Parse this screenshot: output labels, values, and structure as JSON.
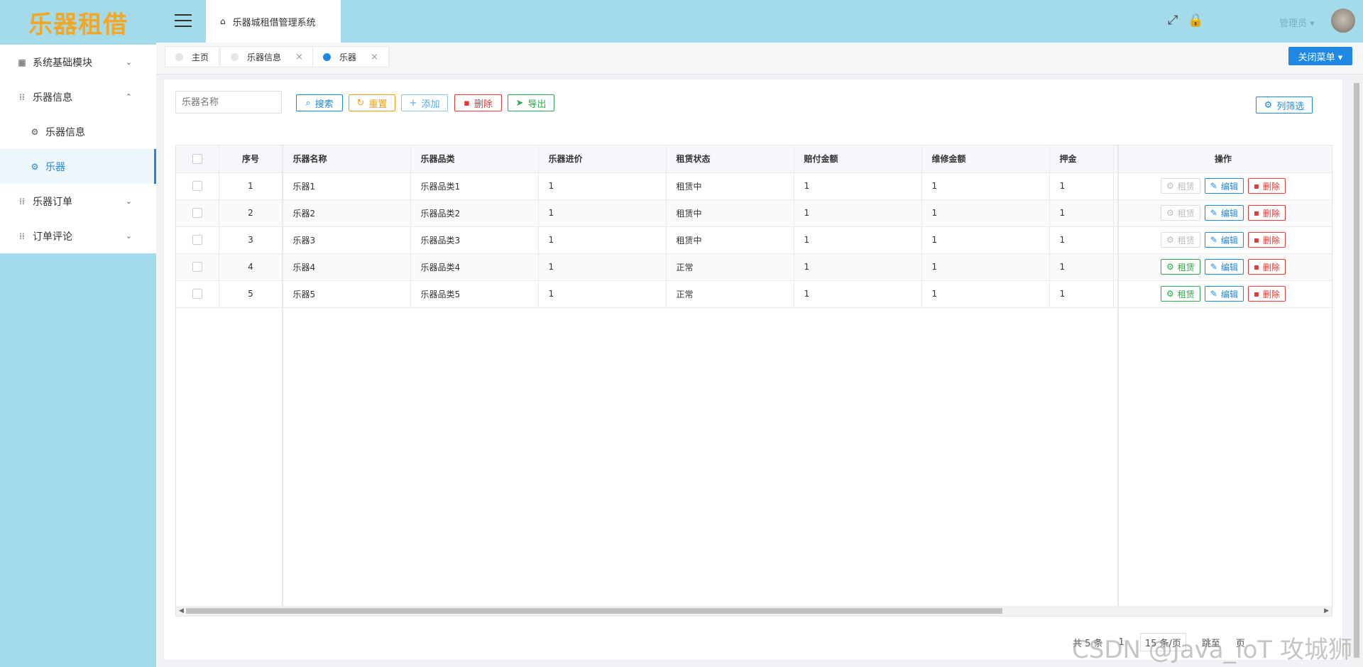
{
  "app": {
    "logo": "乐器租借",
    "system_title": "乐器城租借管理系统",
    "user_name": "管理员",
    "user_chevron": "▾"
  },
  "sidebar": {
    "items": [
      {
        "label": "系统基础模块",
        "icon": "chart-icon",
        "chevron": "⌄"
      },
      {
        "label": "乐器信息",
        "icon": "grid-icon",
        "chevron": "⌃"
      },
      {
        "label": "乐器信息",
        "icon": "gear-icon"
      },
      {
        "label": "乐器",
        "icon": "gear-icon"
      },
      {
        "label": "乐器订单",
        "icon": "grid-icon",
        "chevron": "⌄"
      },
      {
        "label": "订单评论",
        "icon": "grid-icon",
        "chevron": "⌄"
      }
    ]
  },
  "tabs": [
    {
      "label": "主页"
    },
    {
      "label": "乐器信息",
      "close": "×"
    },
    {
      "label": "乐器",
      "close": "×"
    }
  ],
  "close_menu": {
    "label": "关闭菜单 ▾"
  },
  "toolbar": {
    "search_placeholder": "乐器名称",
    "search": "搜索",
    "reset": "重置",
    "add": "添加",
    "delete": "删除",
    "export": "导出",
    "column_filter": "列筛选"
  },
  "table": {
    "headers": [
      "序号",
      "乐器名称",
      "乐器品类",
      "乐器进价",
      "租赁状态",
      "赔付金额",
      "维修金额",
      "押金",
      "操作"
    ],
    "rows": [
      {
        "no": "1",
        "name": "乐器1",
        "category": "乐器品类1",
        "price": "1",
        "status": "租赁中",
        "comp": "1",
        "repair": "1",
        "deposit": "1"
      },
      {
        "no": "2",
        "name": "乐器2",
        "category": "乐器品类2",
        "price": "1",
        "status": "租赁中",
        "comp": "1",
        "repair": "1",
        "deposit": "1"
      },
      {
        "no": "3",
        "name": "乐器3",
        "category": "乐器品类3",
        "price": "1",
        "status": "租赁中",
        "comp": "1",
        "repair": "1",
        "deposit": "1"
      },
      {
        "no": "4",
        "name": "乐器4",
        "category": "乐器品类4",
        "price": "1",
        "status": "正常",
        "comp": "1",
        "repair": "1",
        "deposit": "1"
      },
      {
        "no": "5",
        "name": "乐器5",
        "category": "乐器品类5",
        "price": "1",
        "status": "正常",
        "comp": "1",
        "repair": "1",
        "deposit": "1"
      }
    ],
    "actions": {
      "rent": "租赁",
      "edit": "编辑",
      "delete": "删除"
    }
  },
  "pagination": {
    "total": "共 5 条",
    "page": "1",
    "page_size": "15 条/页",
    "goto": "跳至",
    "page_suffix": "页"
  },
  "watermark": "CSDN @Java_IoT 攻城狮",
  "colors": {
    "accent": "#1e88e5",
    "header_bg": "#a3dbea",
    "logo": "#f5a623",
    "danger": "#e53935",
    "success": "#2eaa4a"
  }
}
